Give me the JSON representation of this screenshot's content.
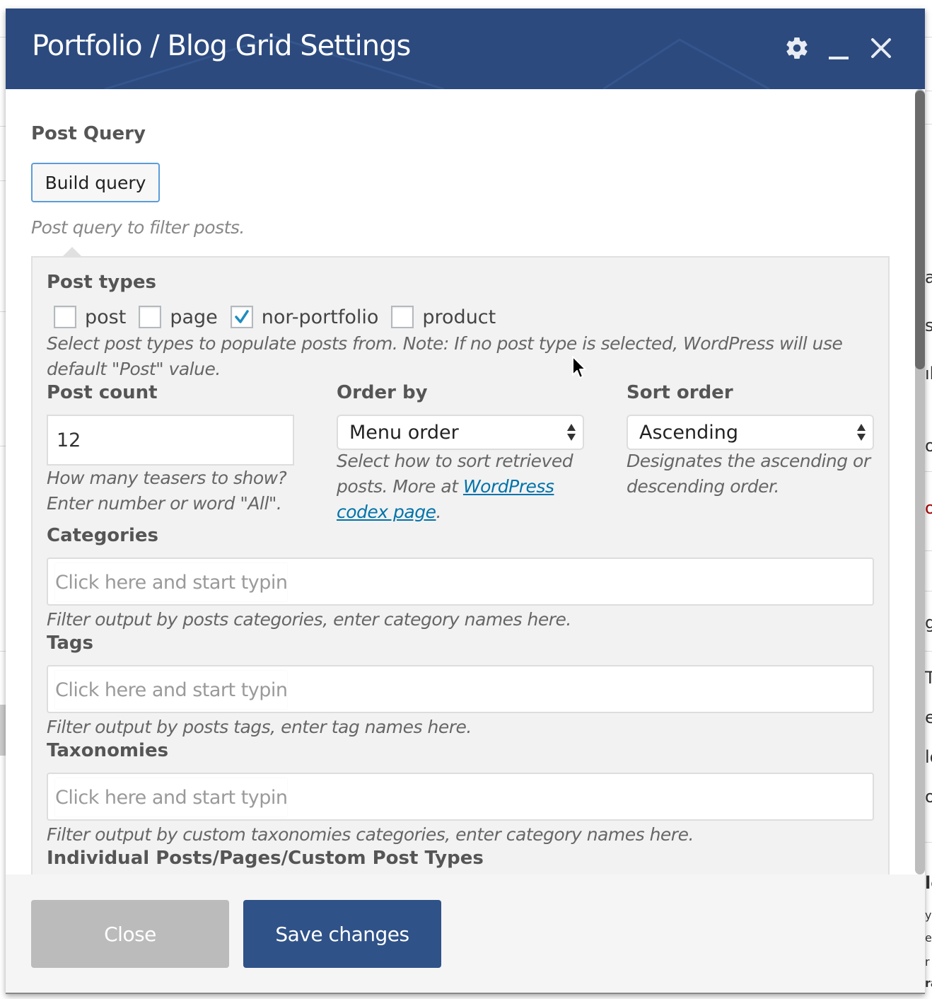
{
  "modal": {
    "title": "Portfolio / Blog Grid Settings",
    "header_icons": [
      "gear-icon",
      "minimize-icon",
      "close-icon"
    ],
    "accent_color": "#2c4a7e"
  },
  "post_query": {
    "label": "Post Query",
    "build_button": "Build query",
    "help": "Post query to filter posts."
  },
  "post_types": {
    "label": "Post types",
    "options": [
      {
        "label": "post",
        "checked": false
      },
      {
        "label": "page",
        "checked": false
      },
      {
        "label": "nor-portfolio",
        "checked": true
      },
      {
        "label": "product",
        "checked": false
      }
    ],
    "help": "Select post types to populate posts from. Note: If no post type is selected, WordPress will use default \"Post\" value."
  },
  "post_count": {
    "label": "Post count",
    "value": "12",
    "help_line1": "How many teasers to show?",
    "help_line2": "Enter number or word \"All\"."
  },
  "order_by": {
    "label": "Order by",
    "selected": "Menu order",
    "help_line1": "Select how to sort retrieved",
    "help_line2_prefix": "posts. More at ",
    "link_part1": "WordPress",
    "link_part2": "codex page",
    "help_suffix": "."
  },
  "sort_order": {
    "label": "Sort order",
    "selected": "Ascending",
    "help_line1": "Designates the ascending or",
    "help_line2": "descending order."
  },
  "categories": {
    "label": "Categories",
    "placeholder": "Click here and start typing...",
    "help": "Filter output by posts categories, enter category names here."
  },
  "tags": {
    "label": "Tags",
    "placeholder": "Click here and start typing...",
    "help": "Filter output by posts tags, enter tag names here."
  },
  "taxonomies": {
    "label": "Taxonomies",
    "placeholder": "Click here and start typing...",
    "help": "Filter output by custom taxonomies categories, enter category names here."
  },
  "individual": {
    "label": "Individual Posts/Pages/Custom Post Types"
  },
  "footer": {
    "close_label": "Close",
    "save_label": "Save changes"
  },
  "background_fragments": [
    "a",
    "si",
    "ıb",
    "os",
    "o",
    "g",
    "T",
    "e",
    "lo",
    "o",
    "le",
    "y",
    "e",
    "r",
    "ra"
  ]
}
